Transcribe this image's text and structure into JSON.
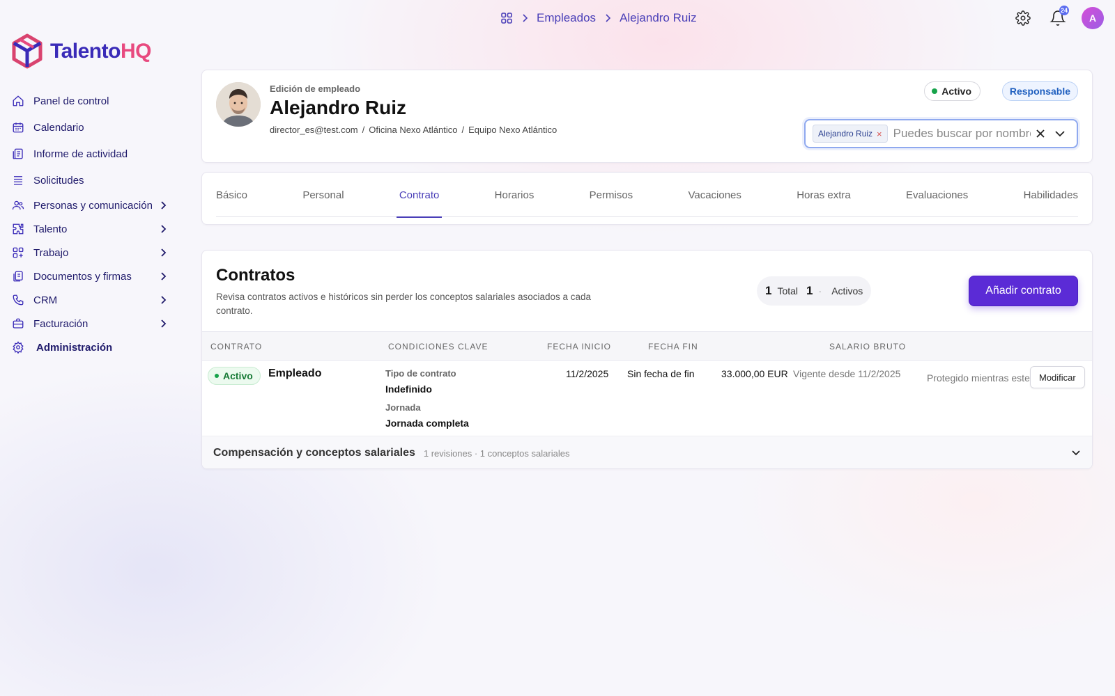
{
  "breadcrumb": {
    "section": "Empleados",
    "current": "Alejandro Ruiz"
  },
  "topbar": {
    "notifications_count": "24",
    "avatar_initial": "A"
  },
  "brand": {
    "name_part1": "Talento",
    "name_part2": "HQ"
  },
  "sidebar": {
    "items": [
      {
        "label": "Panel de control",
        "icon": "home-icon"
      },
      {
        "label": "Calendario",
        "icon": "calendar-icon"
      },
      {
        "label": "Informe de actividad",
        "icon": "report-icon"
      },
      {
        "label": "Solicitudes",
        "icon": "list-icon"
      },
      {
        "label": "Personas y comunicación",
        "icon": "people-icon",
        "expandable": true
      },
      {
        "label": "Talento",
        "icon": "puzzle-icon",
        "expandable": true
      },
      {
        "label": "Trabajo",
        "icon": "grid-plus-icon",
        "expandable": true
      },
      {
        "label": "Documentos y firmas",
        "icon": "documents-icon",
        "expandable": true
      },
      {
        "label": "CRM",
        "icon": "phone-icon",
        "expandable": true
      },
      {
        "label": "Facturación",
        "icon": "briefcase-icon",
        "expandable": true
      },
      {
        "label": "Administración",
        "icon": "gear-icon"
      }
    ]
  },
  "employee": {
    "kicker": "Edición de empleado",
    "name": "Alejandro Ruiz",
    "email": "director_es@test.com",
    "office": "Oficina Nexo Atlántico",
    "team": "Equipo Nexo Atlántico",
    "status": "Activo",
    "role": "Responsable",
    "meta_sep": "/"
  },
  "search": {
    "chip": "Alejandro Ruiz",
    "placeholder": "Puedes buscar por nombre"
  },
  "tabs": [
    "Básico",
    "Personal",
    "Contrato",
    "Horarios",
    "Permisos",
    "Vacaciones",
    "Horas extra",
    "Evaluaciones",
    "Habilidades"
  ],
  "active_tab": "Contrato",
  "contracts": {
    "title": "Contratos",
    "description": "Revisa contratos activos e históricos sin perder los conceptos salariales asociados a cada contrato.",
    "total_count": "1",
    "total_label": "Total",
    "active_count": "1",
    "active_sep": "·",
    "active_label": "Activos",
    "add_button": "Añadir contrato",
    "columns": {
      "contract": "CONTRATO",
      "conditions": "CONDICIONES CLAVE",
      "start": "FECHA INICIO",
      "end": "FECHA FIN",
      "salary": "SALARIO BRUTO"
    },
    "row": {
      "status": "Activo",
      "name": "Empleado",
      "contract_type_label": "Tipo de contrato",
      "contract_type_value": "Indefinido",
      "workday_label": "Jornada",
      "workday_value": "Jornada completa",
      "start_date": "11/2/2025",
      "end_date": "Sin fecha de fin",
      "salary": "33.000,00 EUR",
      "valid_since": "Vigente desde 11/2/2025",
      "protected_note": "Protegido mientras este",
      "modify_button": "Modificar"
    },
    "compensation": {
      "title": "Compensación y conceptos salariales",
      "summary": "1 revisiones · 1 conceptos salariales"
    }
  }
}
